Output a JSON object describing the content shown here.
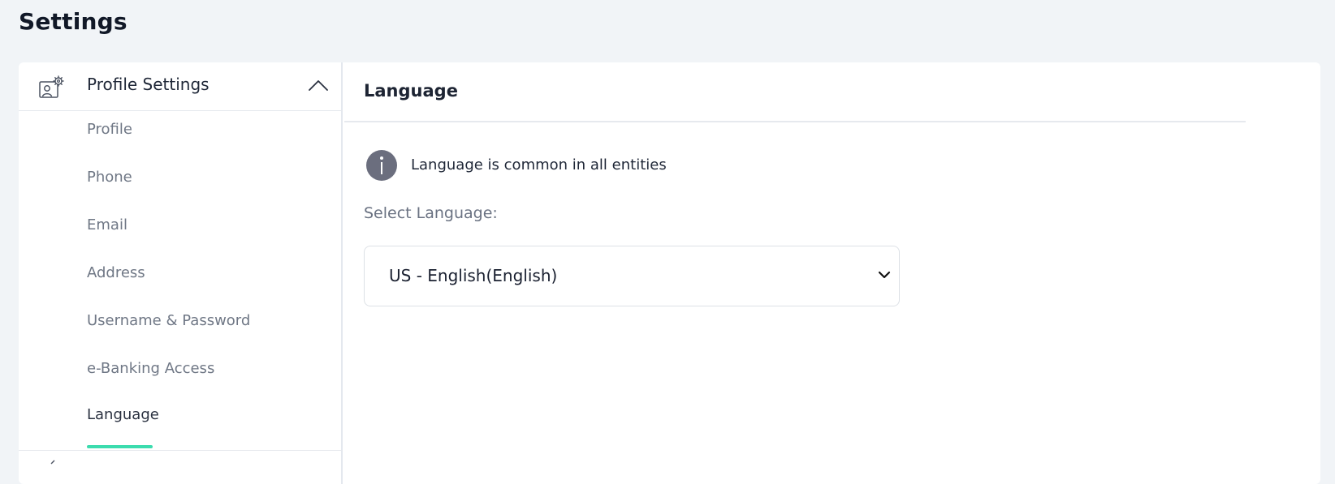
{
  "page": {
    "title": "Settings"
  },
  "sidebar": {
    "group": {
      "label": "Profile Settings",
      "expanded": true,
      "icon": "profile-settings-icon"
    },
    "items": [
      {
        "label": "Profile"
      },
      {
        "label": "Phone"
      },
      {
        "label": "Email"
      },
      {
        "label": "Address"
      },
      {
        "label": "Username & Password"
      },
      {
        "label": "e-Banking Access"
      },
      {
        "label": "Language",
        "active": true
      }
    ]
  },
  "main": {
    "section_title": "Language",
    "info": {
      "icon": "info-icon",
      "text": "Language is common in all entities"
    },
    "select": {
      "label": "Select Language:",
      "value": "US - English(English)"
    }
  },
  "colors": {
    "accent": "#3cdcae",
    "background": "#f1f4f7",
    "info_icon": "#6b6e7e"
  }
}
